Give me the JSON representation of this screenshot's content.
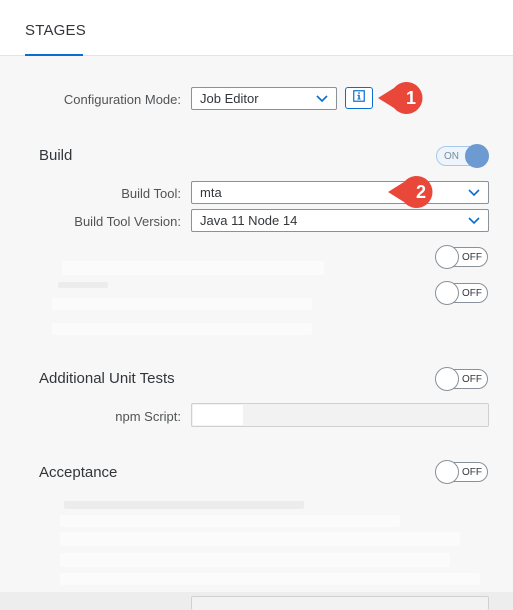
{
  "header": {
    "tab_label": "STAGES"
  },
  "config": {
    "mode_label": "Configuration Mode:",
    "mode_value": "Job Editor",
    "callout_1": "1"
  },
  "build": {
    "title": "Build",
    "switch_label": "ON",
    "tool_label": "Build Tool:",
    "tool_value": "mta",
    "callout_2": "2",
    "version_label": "Build Tool Version:",
    "version_value": "Java 11 Node 14",
    "switch_2_label": "OFF",
    "switch_3_label": "OFF"
  },
  "unit_tests": {
    "title": "Additional Unit Tests",
    "switch_label": "OFF",
    "npm_label": "npm Script:",
    "npm_value": ""
  },
  "acceptance": {
    "title": "Acceptance",
    "switch_label": "OFF"
  },
  "colors": {
    "accent": "#0a6ed1",
    "callout": "#e8473a",
    "switch_on": "#6c9ad1"
  }
}
